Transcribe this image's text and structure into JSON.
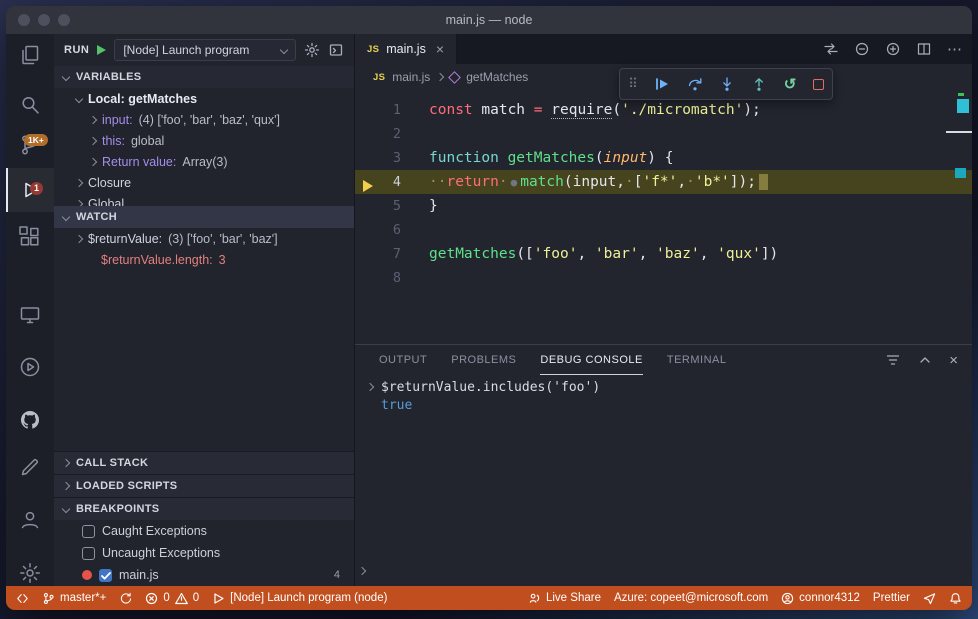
{
  "window": {
    "title": "main.js — node"
  },
  "activity_bar": {
    "scm_badge": "1K+",
    "debug_badge": "1"
  },
  "run_bar": {
    "run_label": "RUN",
    "config": "[Node] Launch program"
  },
  "debug_sidebar": {
    "variables": {
      "header": "VARIABLES",
      "rows": [
        {
          "indent": 1,
          "chevron": "down",
          "name": "Local: getMatches",
          "bold": true
        },
        {
          "indent": 2,
          "chevron": "right",
          "name": "input:",
          "value": "(4) ['foo', 'bar', 'baz', 'qux']",
          "name_class": "purple"
        },
        {
          "indent": 2,
          "chevron": "right",
          "name": "this:",
          "value": "global",
          "name_class": "purple"
        },
        {
          "indent": 2,
          "chevron": "right",
          "name": "Return value:",
          "value": "Array(3)",
          "name_class": "purple"
        },
        {
          "indent": 1,
          "chevron": "right",
          "name": "Closure"
        },
        {
          "indent": 1,
          "chevron": "right",
          "name": "Global"
        }
      ]
    },
    "watch": {
      "header": "WATCH",
      "rows": [
        {
          "indent": 1,
          "chevron": "right",
          "name": "$returnValue:",
          "value": "(3) ['foo', 'bar', 'baz']"
        },
        {
          "indent": 2,
          "chevron": "none",
          "name": "$returnValue.length:",
          "value": "3",
          "row_class": "changed"
        }
      ]
    },
    "call_stack_header": "CALL STACK",
    "loaded_scripts_header": "LOADED SCRIPTS",
    "breakpoints": {
      "header": "BREAKPOINTS",
      "caught": "Caught Exceptions",
      "uncaught": "Uncaught Exceptions",
      "file": "main.js",
      "file_line": "4"
    }
  },
  "editor": {
    "tab_label": "main.js",
    "tab_icon": "JS",
    "breadcrumb_file": "main.js",
    "breadcrumb_symbol": "getMatches",
    "code_lines": [
      {
        "num": 1,
        "tokens": [
          {
            "t": "const",
            "c": "kw"
          },
          {
            "t": " ",
            "c": "pun"
          },
          {
            "t": "match",
            "c": "fg"
          },
          {
            "t": " ",
            "c": "pun"
          },
          {
            "t": "=",
            "c": "kw"
          },
          {
            "t": " ",
            "c": "pun"
          },
          {
            "t": "require",
            "c": "req"
          },
          {
            "t": "(",
            "c": "pun"
          },
          {
            "t": "'./micromatch'",
            "c": "str"
          },
          {
            "t": ");",
            "c": "pun"
          }
        ]
      },
      {
        "num": 2,
        "tokens": []
      },
      {
        "num": 3,
        "tokens": [
          {
            "t": "function",
            "c": "cy"
          },
          {
            "t": " ",
            "c": "pun"
          },
          {
            "t": "getMatches",
            "c": "fn"
          },
          {
            "t": "(",
            "c": "pun"
          },
          {
            "t": "input",
            "c": "param"
          },
          {
            "t": ") {",
            "c": "pun"
          }
        ]
      },
      {
        "num": 4,
        "current": true,
        "tokens": [
          {
            "t": "··",
            "c": "ws"
          },
          {
            "t": "return",
            "c": "kw"
          },
          {
            "t": "·",
            "c": "ws"
          },
          {
            "t": "●",
            "c": "bpdot"
          },
          {
            "t": "match",
            "c": "fn"
          },
          {
            "t": "(",
            "c": "pun"
          },
          {
            "t": "input",
            "c": "fg"
          },
          {
            "t": ",",
            "c": "pun"
          },
          {
            "t": "·",
            "c": "ws"
          },
          {
            "t": "[",
            "c": "pun"
          },
          {
            "t": "'f*'",
            "c": "str"
          },
          {
            "t": ",",
            "c": "pun"
          },
          {
            "t": "·",
            "c": "ws"
          },
          {
            "t": "'b*'",
            "c": "str"
          },
          {
            "t": "]);",
            "c": "pun"
          },
          {
            "t": "",
            "c": "endmark"
          }
        ]
      },
      {
        "num": 5,
        "tokens": [
          {
            "t": "}",
            "c": "pun"
          }
        ]
      },
      {
        "num": 6,
        "tokens": []
      },
      {
        "num": 7,
        "tokens": [
          {
            "t": "getMatches",
            "c": "fn"
          },
          {
            "t": "(",
            "c": "pun"
          },
          {
            "t": "[",
            "c": "pun"
          },
          {
            "t": "'foo'",
            "c": "str"
          },
          {
            "t": ", ",
            "c": "pun"
          },
          {
            "t": "'bar'",
            "c": "str"
          },
          {
            "t": ", ",
            "c": "pun"
          },
          {
            "t": "'baz'",
            "c": "str"
          },
          {
            "t": ", ",
            "c": "pun"
          },
          {
            "t": "'qux'",
            "c": "str"
          },
          {
            "t": "])",
            "c": "pun"
          }
        ]
      },
      {
        "num": 8,
        "tokens": []
      }
    ]
  },
  "panel": {
    "tabs": [
      "OUTPUT",
      "PROBLEMS",
      "DEBUG CONSOLE",
      "TERMINAL"
    ],
    "active_tab": "DEBUG CONSOLE",
    "entry_expression": "$returnValue.includes('foo')",
    "entry_result": "true"
  },
  "status_bar": {
    "branch": "master*+",
    "errors": "0",
    "warnings": "0",
    "debug_target": "[Node] Launch program (node)",
    "live_share": "Live Share",
    "azure": "Azure: copeet@microsoft.com",
    "account": "connor4312",
    "formatter": "Prettier"
  },
  "icons": {
    "gripper": "⠿",
    "restart": "↺",
    "more": "⋯",
    "close": "×"
  }
}
